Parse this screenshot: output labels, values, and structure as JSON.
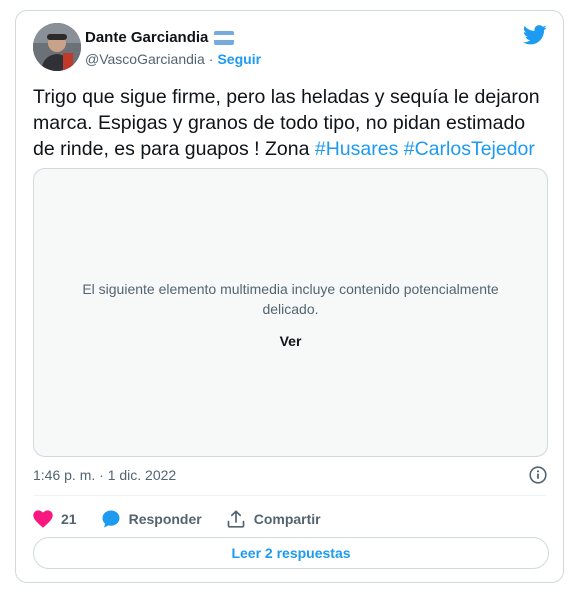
{
  "author": {
    "name": "Dante Garciandia",
    "handle": "@VascoGarciandia",
    "separator": "·",
    "follow_label": "Seguir",
    "flag_icon": "argentina-flag-icon"
  },
  "tweet": {
    "text_main": "Trigo que sigue firme, pero las heladas y sequía le dejaron marca. Espigas y granos de todo tipo, no pidan estimado de rinde, es para guapos ! Zona ",
    "hashtags": [
      "#Husares",
      "#CarlosTejedor"
    ]
  },
  "media": {
    "warning": "El siguiente elemento multimedia incluye contenido potencialmente delicado.",
    "reveal_label": "Ver"
  },
  "timestamp": "1:46 p. m. · 1 dic. 2022",
  "actions": {
    "like_count": "21",
    "reply_label": "Responder",
    "share_label": "Compartir"
  },
  "read_replies_label": "Leer 2 respuestas",
  "colors": {
    "accent": "#1d9bf0",
    "like": "#f91880",
    "border": "#cfd9de",
    "muted": "#536471"
  }
}
